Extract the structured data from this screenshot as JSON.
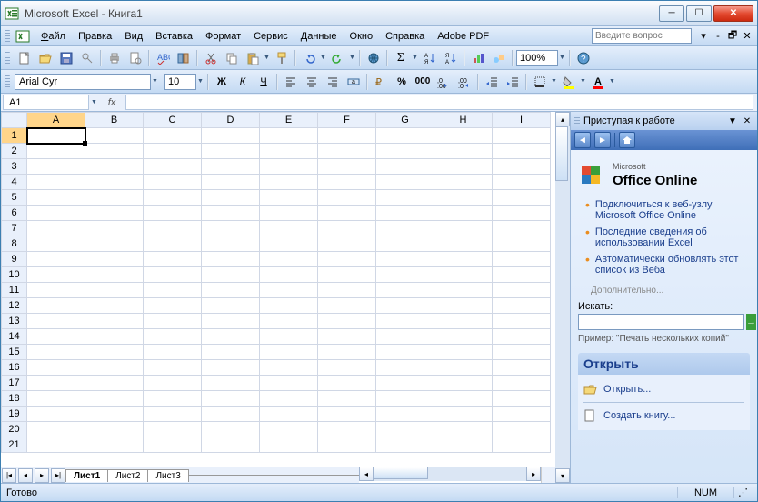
{
  "window": {
    "title": "Microsoft Excel - Книга1"
  },
  "menu": {
    "file": "Файл",
    "edit": "Правка",
    "view": "Вид",
    "insert": "Вставка",
    "format": "Формат",
    "tools": "Сервис",
    "data": "Данные",
    "window": "Окно",
    "help": "Справка",
    "adobe": "Adobe PDF"
  },
  "help_placeholder": "Введите вопрос",
  "toolbar": {
    "zoom": "100%"
  },
  "format": {
    "font_name": "Arial Cyr",
    "font_size": "10"
  },
  "name_box": "A1",
  "columns": [
    "A",
    "B",
    "C",
    "D",
    "E",
    "F",
    "G",
    "H",
    "I"
  ],
  "rows": [
    "1",
    "2",
    "3",
    "4",
    "5",
    "6",
    "7",
    "8",
    "9",
    "10",
    "11",
    "12",
    "13",
    "14",
    "15",
    "16",
    "17",
    "18",
    "19",
    "20",
    "21"
  ],
  "selected_cell": "A1",
  "tabs": [
    "Лист1",
    "Лист2",
    "Лист3"
  ],
  "active_tab": 0,
  "taskpane": {
    "title": "Приступая к работе",
    "office_online_prefix": "Microsoft",
    "office_online_main": "Office Online",
    "links": [
      "Подключиться к веб-узлу Microsoft Office Online",
      "Последние сведения об использовании Excel",
      "Автоматически обновлять этот список из Веба"
    ],
    "more": "Дополнительно...",
    "search_label": "Искать:",
    "example_label": "Пример:",
    "example_text": "\"Печать нескольких копий\"",
    "open_header": "Открыть",
    "open_action": "Открыть...",
    "create_action": "Создать книгу..."
  },
  "status": {
    "ready": "Готово",
    "num": "NUM"
  }
}
